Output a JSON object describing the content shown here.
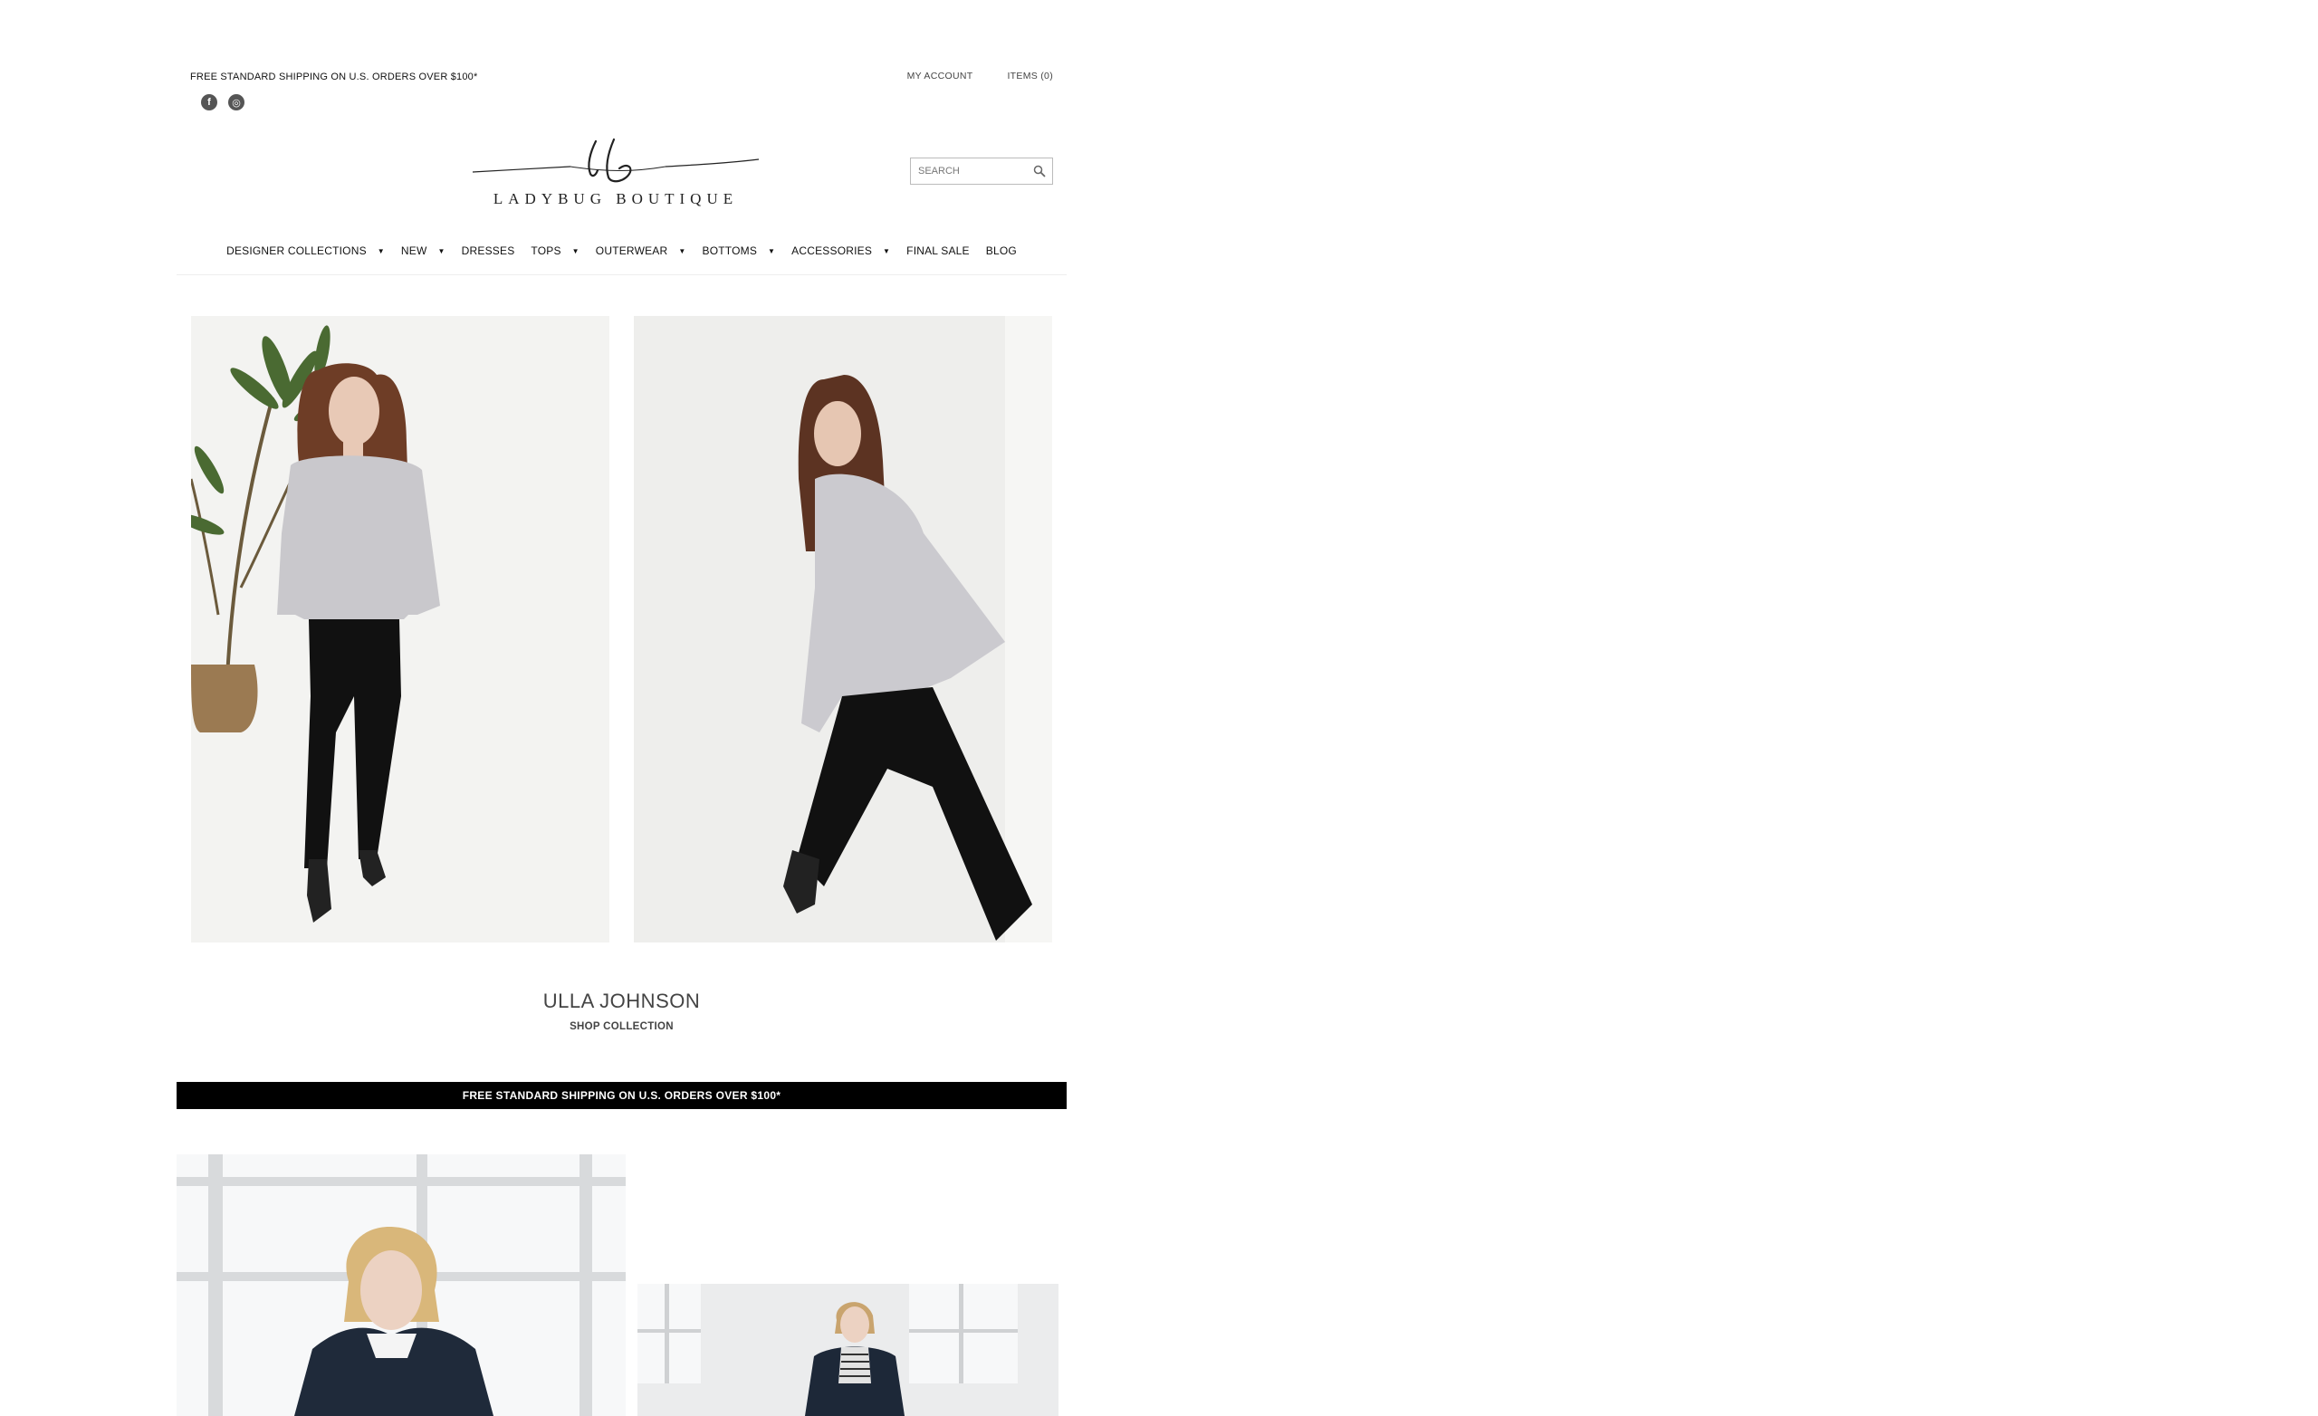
{
  "header": {
    "promo_text": "FREE STANDARD SHIPPING ON U.S. ORDERS OVER $100*",
    "social": [
      {
        "icon": "facebook-icon",
        "glyph": "f"
      },
      {
        "icon": "instagram-icon",
        "glyph": "◎"
      }
    ],
    "my_account": "MY ACCOUNT",
    "items": "ITEMS (0)",
    "search_placeholder": "SEARCH",
    "logo_monogram": "lb",
    "logo_text": "LADYBUG BOUTIQUE"
  },
  "nav": {
    "items": [
      {
        "label": "DESIGNER COLLECTIONS",
        "has_dropdown": true
      },
      {
        "label": "NEW",
        "has_dropdown": true
      },
      {
        "label": "DRESSES",
        "has_dropdown": false
      },
      {
        "label": "TOPS",
        "has_dropdown": true
      },
      {
        "label": "OUTERWEAR",
        "has_dropdown": true
      },
      {
        "label": "BOTTOMS",
        "has_dropdown": true
      },
      {
        "label": "ACCESSORIES",
        "has_dropdown": true
      },
      {
        "label": "FINAL SALE",
        "has_dropdown": false
      },
      {
        "label": "BLOG",
        "has_dropdown": false
      }
    ],
    "caret": "▼"
  },
  "feature": {
    "title": "ULLA JOHNSON",
    "cta": "SHOP COLLECTION"
  },
  "promo_bar": {
    "text": "FREE STANDARD SHIPPING ON U.S. ORDERS OVER $100*"
  },
  "colors": {
    "promo_bar_bg": "#000000",
    "text": "#222222",
    "muted": "#444444"
  }
}
